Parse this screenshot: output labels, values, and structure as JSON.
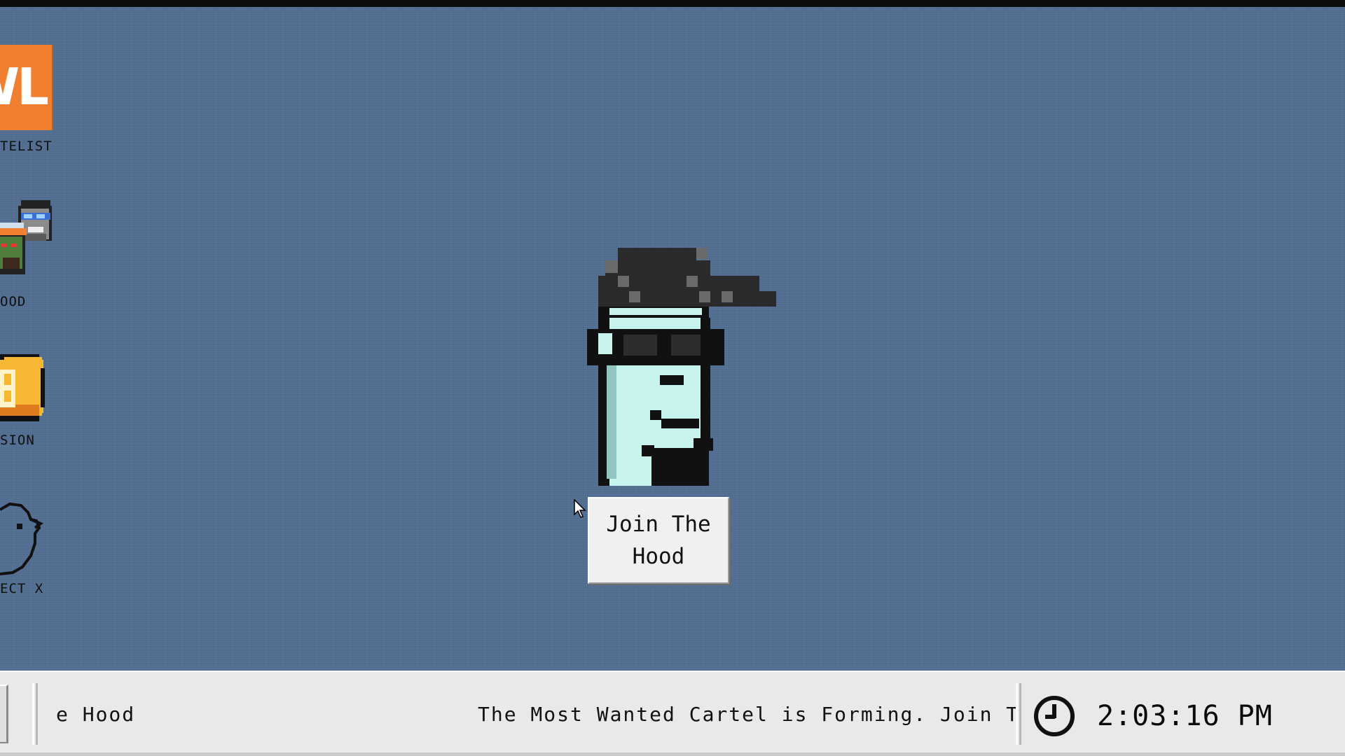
{
  "desktop": {
    "icons": [
      {
        "label": "TELIST",
        "glyph": "WL",
        "icon": "whitelist-icon",
        "color": "#f07f2f"
      },
      {
        "label": "OOD",
        "icon": "hood-punks-icon"
      },
      {
        "label": "SION",
        "icon": "bitcoin-coin-icon",
        "color": "#f7b733"
      },
      {
        "label": "ECT X",
        "icon": "bird-outline-icon"
      }
    ],
    "center_avatar": {
      "icon": "pixel-punk-avatar-icon"
    },
    "join_button": {
      "label": "Join The Hood"
    }
  },
  "taskbar": {
    "marquee_left": "e Hood",
    "marquee_right": "The Most Wanted Cartel is Forming. Join The",
    "clock_icon": "clock-icon",
    "time": "2:03:16 PM"
  },
  "colors": {
    "desktop_bg": "#4f6b8e",
    "taskbar_bg": "#e9e9e9",
    "accent_orange": "#f07f2f"
  }
}
